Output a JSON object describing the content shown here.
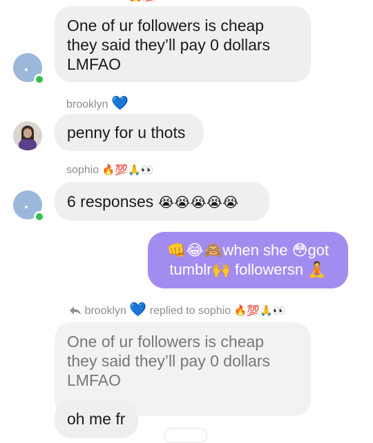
{
  "messages": [
    {
      "lines": [
        "One of ur followers is cheap",
        "they said they’ll pay 0 dollars",
        "LMFAO"
      ]
    },
    {
      "sender": "brooklyn",
      "sender_badge": "💙",
      "text": "penny for u thots"
    },
    {
      "sender": "sophio",
      "sender_badge": "🔥💯🙏👀",
      "text": "6 responses",
      "emoji": "😭😭😭😭😭"
    },
    {
      "outgoing": true,
      "line1": "👊😂🙈when she 😳got",
      "line2": "tumblr🙌 followersn 🧘"
    },
    {
      "reply_header": {
        "sender": "brooklyn",
        "sender_badge": "💙",
        "replied_text": "replied to sophio",
        "target_badge": "🔥💯🙏👀"
      },
      "quoted_lines": [
        "One of ur followers is cheap",
        "they said they’ll pay 0 dollars",
        "LMFAO"
      ],
      "reply_text": "oh me fr"
    }
  ],
  "icons": {
    "reply": "reply-arrow-icon",
    "online": "online-status-icon"
  },
  "colors": {
    "incoming_bubble": "#efefef",
    "outgoing_bubble": "#a38cf0",
    "online": "#33c04a",
    "heart": "#3f9af0"
  }
}
